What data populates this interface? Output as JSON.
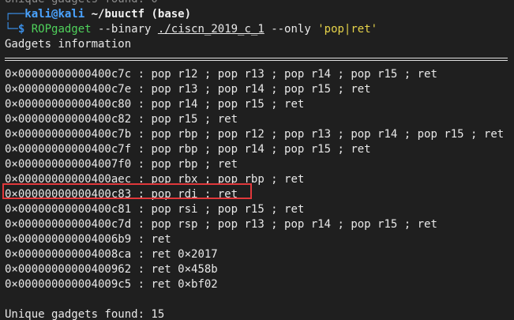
{
  "top_cut_line": "Unique gadgets found: 0",
  "prompt": {
    "user_host": "kali@kali",
    "cwd": "~/buuctf",
    "env": "(base)",
    "dollar": "$",
    "command": "ROPgadget",
    "arg_binary": "--binary",
    "path": "./ciscn_2019_c_1",
    "arg_only": "--only",
    "only_value": "'pop|ret'"
  },
  "header": "Gadgets information",
  "gadgets": [
    {
      "addr": "0×00000000000400c7c",
      "instr": "pop r12 ; pop r13 ; pop r14 ; pop r15 ; ret"
    },
    {
      "addr": "0×00000000000400c7e",
      "instr": "pop r13 ; pop r14 ; pop r15 ; ret"
    },
    {
      "addr": "0×00000000000400c80",
      "instr": "pop r14 ; pop r15 ; ret"
    },
    {
      "addr": "0×00000000000400c82",
      "instr": "pop r15 ; ret"
    },
    {
      "addr": "0×00000000000400c7b",
      "instr": "pop rbp ; pop r12 ; pop r13 ; pop r14 ; pop r15 ; ret"
    },
    {
      "addr": "0×00000000000400c7f",
      "instr": "pop rbp ; pop r14 ; pop r15 ; ret"
    },
    {
      "addr": "0×000000000004007f0",
      "instr": "pop rbp ; ret"
    },
    {
      "addr": "0×00000000000400aec",
      "instr": "pop rbx ; pop rbp ; ret"
    },
    {
      "addr": "0×00000000000400c83",
      "instr": "pop rdi ; ret"
    },
    {
      "addr": "0×00000000000400c81",
      "instr": "pop rsi ; pop r15 ; ret"
    },
    {
      "addr": "0×00000000000400c7d",
      "instr": "pop rsp ; pop r13 ; pop r14 ; pop r15 ; ret"
    },
    {
      "addr": "0×000000000004006b9",
      "instr": "ret"
    },
    {
      "addr": "0×000000000004008ca",
      "instr": "ret 0×2017"
    },
    {
      "addr": "0×00000000000400962",
      "instr": "ret 0×458b"
    },
    {
      "addr": "0×000000000004009c5",
      "instr": "ret 0×bf02"
    }
  ],
  "separator": " : ",
  "footer": "Unique gadgets found: 15",
  "colors": {
    "background": "#1f1f1f",
    "highlight_box": "#e0383b",
    "command": "#4fd15b",
    "string": "#e6d34a",
    "user": "#4aa3ff"
  }
}
